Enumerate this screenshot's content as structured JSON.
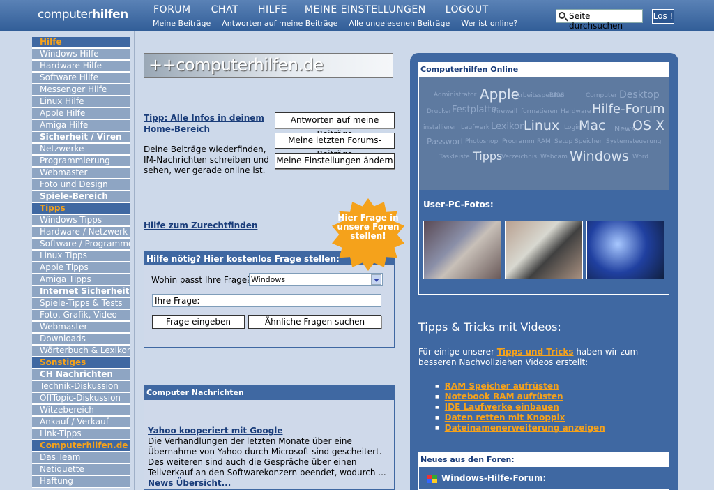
{
  "header": {
    "logo_light": "computer",
    "logo_bold": "hilfen",
    "nav": [
      "FORUM",
      "CHAT",
      "HILFE",
      "MEINE EINSTELLUNGEN",
      "LOGOUT"
    ],
    "subnav": [
      "Meine Beiträge",
      "Antworten auf meine Beiträge",
      "Alle ungelesenen Beiträge",
      "Wer ist online?"
    ],
    "search_placeholder": "Seite durchsuchen",
    "search_button": "Los !"
  },
  "sidebar": [
    {
      "label": "Hilfe",
      "type": "head"
    },
    {
      "label": "Windows Hilfe"
    },
    {
      "label": "Hardware Hilfe"
    },
    {
      "label": "Software Hilfe"
    },
    {
      "label": "Messenger Hilfe"
    },
    {
      "label": "Linux Hilfe"
    },
    {
      "label": "Apple Hilfe"
    },
    {
      "label": "Amiga Hilfe"
    },
    {
      "label": "Sicherheit / Viren",
      "type": "bold"
    },
    {
      "label": "Netzwerke"
    },
    {
      "label": "Programmierung"
    },
    {
      "label": "Webmaster"
    },
    {
      "label": "Foto und Design"
    },
    {
      "label": "Spiele-Bereich",
      "type": "bold"
    },
    {
      "label": "Tipps",
      "type": "head"
    },
    {
      "label": "Windows Tipps"
    },
    {
      "label": "Hardware / Netzwerk"
    },
    {
      "label": "Software / Programme"
    },
    {
      "label": "Linux Tipps"
    },
    {
      "label": "Apple Tipps"
    },
    {
      "label": "Amiga Tipps"
    },
    {
      "label": "Internet Sicherheit",
      "type": "bold"
    },
    {
      "label": "Spiele-Tipps & Tests"
    },
    {
      "label": "Foto, Grafik, Video"
    },
    {
      "label": "Webmaster"
    },
    {
      "label": "Downloads"
    },
    {
      "label": "Wörterbuch & Lexikon"
    },
    {
      "label": "Sonstiges",
      "type": "head"
    },
    {
      "label": "CH Nachrichten",
      "type": "bold"
    },
    {
      "label": "Technik-Diskussion"
    },
    {
      "label": "OffTopic-Diskussion"
    },
    {
      "label": "Witzebereich"
    },
    {
      "label": "Ankauf / Verkauf"
    },
    {
      "label": "Link-Tipps"
    },
    {
      "label": "Computerhilfen.de",
      "type": "head"
    },
    {
      "label": "Das Team"
    },
    {
      "label": "Netiquette"
    },
    {
      "label": "Haftung"
    }
  ],
  "banner": "++computerhilfen.de",
  "tipp": {
    "link": "Tipp: Alle Infos in deinem Home-Bereich",
    "text": "Deine Beiträge wiederfinden, IM-Nachrichten schreiben und sehen, wer gerade online ist.",
    "buttons": [
      "Antworten auf meine Beiträge",
      "Meine letzten Forums-Beiträge",
      "Meine Einstellungen ändern"
    ]
  },
  "hilfe_link": "Hilfe zum Zurechtfinden",
  "star_text": "Hier Frage in unsere Foren stellen!",
  "question": {
    "title": "Hilfe nötig? Hier kostenlos Frage stellen:",
    "where_label": "Wohin passt Ihre Frage?",
    "select_value": "Windows",
    "input_placeholder": "Ihre Frage:",
    "submit_button": "Frage eingeben",
    "similar_button": "Ähnliche Fragen suchen"
  },
  "news": {
    "title": "Computer Nachrichten",
    "headline": "Yahoo kooperiert mit Google",
    "text": "Die Verhandlungen der letzten Monate über eine Übernahme von Yahoo durch Microsoft sind gescheitert. Des weiteren sind auch die Gespräche über einen Teilverkauf an den Softwarekonzern beendet, wodurch ...",
    "more_link": "News Übersicht..."
  },
  "online": {
    "title": "Computerhilfen Online",
    "tags": [
      "Administrator",
      "Apple",
      "Arbeitsspeicher",
      "BIOS",
      "Computer",
      "Desktop",
      "Drucker",
      "Festplatte",
      "Firewall",
      "formatieren",
      "Hardware",
      "Hilfe-Forum",
      "installieren",
      "Laufwerk",
      "Lexikon",
      "Linux",
      "Login",
      "Mac",
      "News",
      "OS X",
      "Passwort",
      "Photoshop",
      "Programm",
      "RAM",
      "Setup",
      "Speicher",
      "Systemsteuerung",
      "Taskleiste",
      "Tipps",
      "Verzeichnis",
      "Webcam",
      "Windows",
      "Word"
    ],
    "user_fotos": "User-PC-Fotos:"
  },
  "videos": {
    "title": "Tipps & Tricks mit Videos:",
    "intro_before": "Für einige unserer ",
    "intro_link": "Tipps und Tricks",
    "intro_after": " haben wir zum besseren Nachvollziehen Videos erstellt:",
    "links": [
      "RAM Speicher aufrüsten",
      "Notebook RAM aufrüsten",
      "IDE Laufwerke einbauen",
      "Daten retten mit Knoppix",
      "Dateinamenerweiterung anzeigen"
    ]
  },
  "forum": {
    "title": "Neues aus den Foren:",
    "item": "Windows-Hilfe-Forum:"
  }
}
